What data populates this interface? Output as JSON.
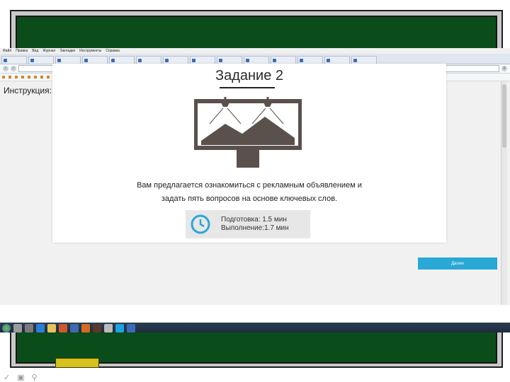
{
  "browser": {
    "menu": [
      "Файл",
      "Правка",
      "Вид",
      "Журнал",
      "Закладки",
      "Инструменты",
      "Справка"
    ],
    "tabs": [
      "",
      "",
      "",
      "",
      "",
      "",
      "",
      "",
      "",
      "",
      "",
      "",
      "",
      ""
    ],
    "url": ""
  },
  "page": {
    "instruction_label": "Инструкция:",
    "task_title": "Задание 2",
    "description_line1": "Вам предлагается ознакомиться с рекламным объявлением и",
    "description_line2": "задать пять вопросов на основе ключевых слов.",
    "prep_label": "Подготовка:",
    "prep_value": "1.5 мин",
    "exec_label": "Выполнение:",
    "exec_value": "1.7 мин",
    "next_button": "Далее"
  },
  "colors": {
    "board": "#0b4d1a",
    "billboard": "#5a514c",
    "accent": "#2aa8d6",
    "chalk": "#d6c21b"
  }
}
